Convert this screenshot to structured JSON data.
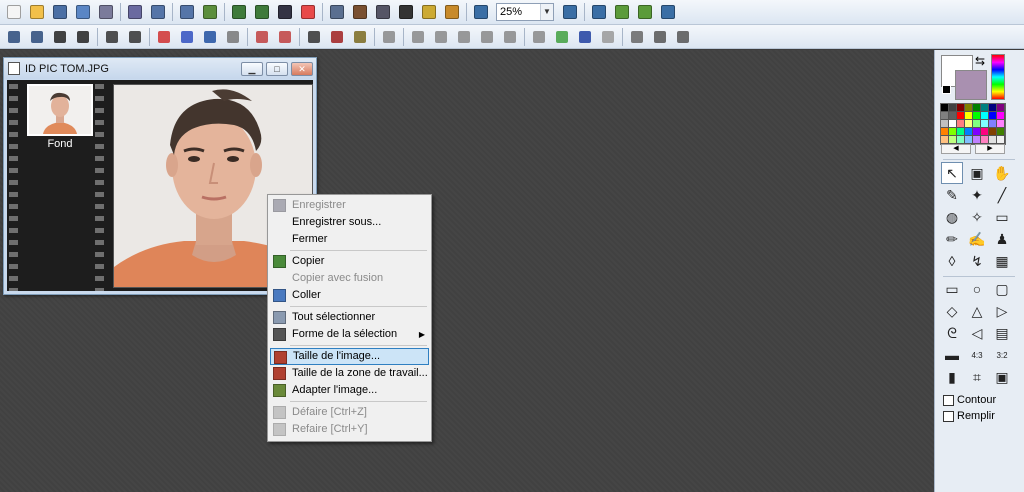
{
  "toolbar1": {
    "zoom_value": "25%",
    "icons": [
      "new-icon",
      "open-icon",
      "save-icon",
      "save-as-icon",
      "print-icon",
      "scan-icon",
      "undo-icon",
      "redo-icon",
      "copy-image-icon",
      "paste-icon",
      "paste-new-icon",
      "frame-icon",
      "color-adjust-icon",
      "resize-image-icon",
      "canvas-size-icon",
      "crop-icon",
      "text-icon",
      "effects-icon",
      "plugin-icon",
      "window-icon",
      "zoom-in-icon",
      "zoom-out-icon",
      "fit-icon",
      "actual-size-icon",
      "fullscreen-icon"
    ]
  },
  "toolbar2": {
    "icons": [
      "rotate-left-icon",
      "rotate-right-icon",
      "flip-h-icon",
      "flip-v-icon",
      "shift-left-icon",
      "shift-right-icon",
      "color-balance-icon",
      "levels-icon",
      "histogram-icon",
      "dither-icon",
      "auto-adjust-icon",
      "auto-adjust-2-icon",
      "grid-icon",
      "mosaic-icon",
      "frame-effect-icon",
      "contrast-icon",
      "brightness-icon",
      "sharpen-icon",
      "blur-icon",
      "emboss-icon",
      "soften-icon",
      "negative-icon",
      "colorize-icon",
      "desaturate-icon",
      "compare-icon",
      "scanner-icon",
      "print-preview-icon",
      "export-icon"
    ]
  },
  "document": {
    "title": "ID PIC TOM.JPG",
    "layer_label": "Fond"
  },
  "context_menu": {
    "items": [
      {
        "label": "Enregistrer",
        "disabled": true,
        "icon": "save-icon"
      },
      {
        "label": "Enregistrer sous...",
        "disabled": false,
        "icon": ""
      },
      {
        "label": "Fermer",
        "disabled": false,
        "icon": ""
      },
      {
        "label": "Copier",
        "disabled": false,
        "icon": "copy-icon"
      },
      {
        "label": "Copier avec fusion",
        "disabled": true,
        "icon": ""
      },
      {
        "label": "Coller",
        "disabled": false,
        "icon": "paste-icon"
      },
      {
        "label": "Tout sélectionner",
        "disabled": false,
        "icon": "select-all-icon"
      },
      {
        "label": "Forme de la sélection",
        "disabled": false,
        "icon": "selection-shape-icon"
      },
      {
        "label": "Taille de l'image...",
        "disabled": false,
        "icon": "image-size-icon",
        "highlighted": true
      },
      {
        "label": "Taille de la zone de travail...",
        "disabled": false,
        "icon": "canvas-size-icon"
      },
      {
        "label": "Adapter l'image...",
        "disabled": false,
        "icon": "fit-image-icon"
      },
      {
        "label": "Défaire [Ctrl+Z]",
        "disabled": true,
        "icon": "undo-icon"
      },
      {
        "label": "Refaire [Ctrl+Y]",
        "disabled": true,
        "icon": "redo-icon"
      }
    ]
  },
  "right_panel": {
    "palette": [
      "#000000",
      "#404040",
      "#800000",
      "#808000",
      "#008000",
      "#008080",
      "#000080",
      "#800080",
      "#808080",
      "#606060",
      "#ff0000",
      "#ffff00",
      "#00ff00",
      "#00ffff",
      "#0000ff",
      "#ff00ff",
      "#c0c0c0",
      "#ffffff",
      "#ff8080",
      "#ffff80",
      "#80ff80",
      "#80ffff",
      "#8080ff",
      "#ff80ff",
      "#ff8000",
      "#80ff00",
      "#00ff80",
      "#0080ff",
      "#8000ff",
      "#ff0080",
      "#804000",
      "#408000",
      "#ffc080",
      "#c0ff80",
      "#80ffc0",
      "#80c0ff",
      "#c080ff",
      "#ff80c0",
      "#e0e0e0",
      "#f0f0f0"
    ],
    "checkboxes": {
      "contour": "Contour",
      "fill": "Remplir"
    },
    "ratio_labels": {
      "r43": "4:3",
      "r32": "3:2"
    }
  }
}
